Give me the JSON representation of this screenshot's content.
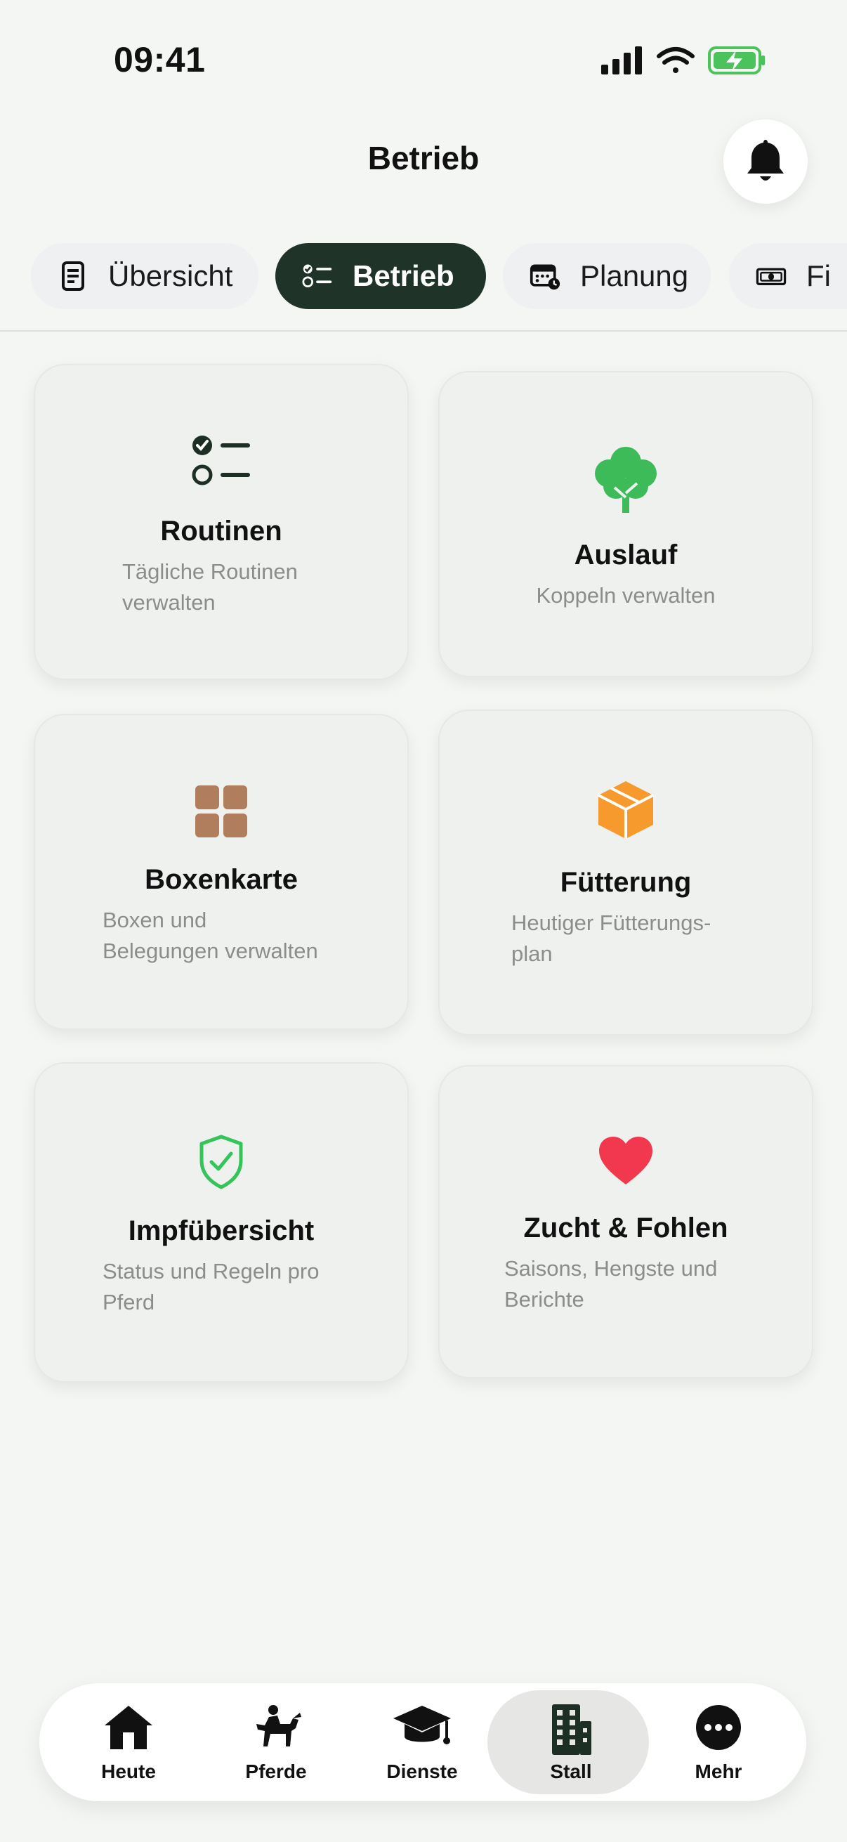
{
  "status": {
    "time": "09:41"
  },
  "header": {
    "title": "Betrieb"
  },
  "tabs": [
    {
      "label": "Übersicht",
      "icon": "document-icon"
    },
    {
      "label": "Betrieb",
      "icon": "checklist-icon",
      "active": true
    },
    {
      "label": "Planung",
      "icon": "calendar-icon"
    },
    {
      "label": "Fi",
      "icon": "money-icon"
    }
  ],
  "cards": [
    {
      "title": "Routinen",
      "subtitle": [
        "Tägliche Routinen",
        "verwalten"
      ],
      "icon": "checklist-icon"
    },
    {
      "title": "Auslauf",
      "subtitle": [
        "Koppeln verwalten"
      ],
      "icon": "tree-icon",
      "color": "#3dbb58"
    },
    {
      "title": "Boxenkarte",
      "subtitle": [
        "Boxen und",
        "Belegungen verwalten"
      ],
      "icon": "grid-icon",
      "color": "#b07e5c"
    },
    {
      "title": "Fütterung",
      "subtitle": [
        "Heutiger Fütterungs-",
        "plan"
      ],
      "icon": "box-icon",
      "color": "#f79a2e"
    },
    {
      "title": "Impfübersicht",
      "subtitle": [
        "Status und Regeln pro",
        "Pferd"
      ],
      "icon": "shield-check-icon",
      "color": "#34c45a"
    },
    {
      "title": "Zucht & Fohlen",
      "subtitle": [
        "Saisons, Hengste und",
        "Berichte"
      ],
      "icon": "heart-icon",
      "color": "#f2384f"
    }
  ],
  "nav": [
    {
      "label": "Heute",
      "icon": "house-icon"
    },
    {
      "label": "Pferde",
      "icon": "rider-icon"
    },
    {
      "label": "Dienste",
      "icon": "graduation-cap-icon"
    },
    {
      "label": "Stall",
      "icon": "building-icon",
      "active": true
    },
    {
      "label": "Mehr",
      "icon": "more-icon"
    }
  ]
}
